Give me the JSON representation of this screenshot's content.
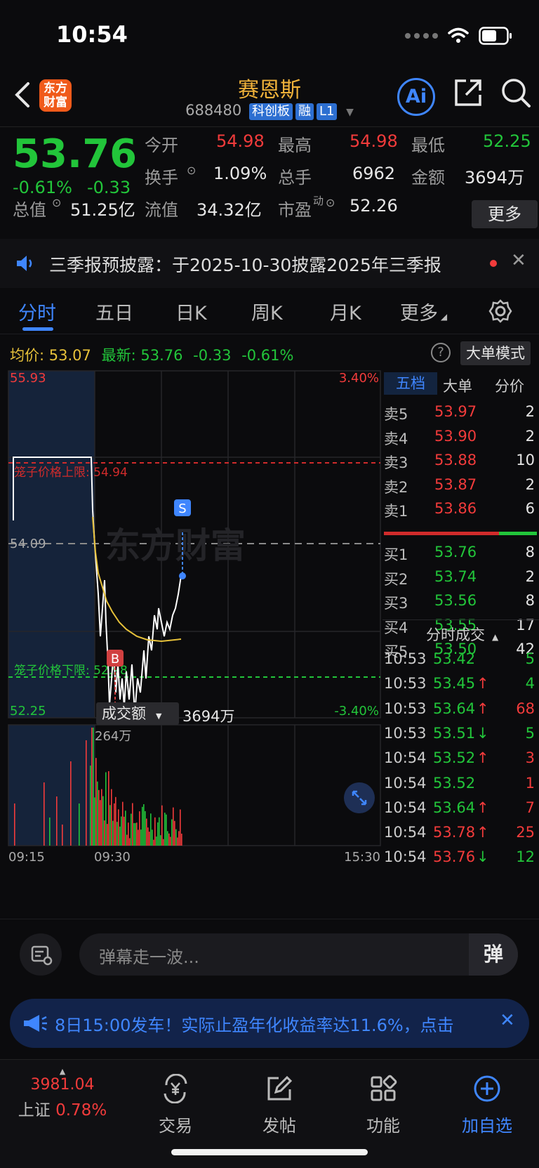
{
  "status_bar": {
    "time": "10:54"
  },
  "header": {
    "logo_text": "东方财富",
    "stock_name": "赛恩斯",
    "code": "688480",
    "tags": [
      "科创板",
      "融",
      "L1"
    ],
    "ai_label": "Ai"
  },
  "quote": {
    "price": "53.76",
    "change_pct": "-0.61%",
    "change": "-0.33",
    "fields": {
      "open_label": "今开",
      "open": "54.98",
      "high_label": "最高",
      "high": "54.98",
      "low_label": "最低",
      "low": "52.25",
      "turnover_label": "换手",
      "turnover": "1.09%",
      "volume_label": "总手",
      "volume": "6962",
      "amount_label": "金额",
      "amount": "3694万",
      "mktcap_label": "总值",
      "mktcap": "51.25亿",
      "float_label": "流值",
      "float": "34.32亿",
      "pe_label": "市盈",
      "pe_sup": "动",
      "pe": "52.26"
    },
    "more_label": "更多"
  },
  "notice": {
    "text": "三季报预披露：于2025-10-30披露2025年三季报"
  },
  "tabs": [
    "分时",
    "五日",
    "日K",
    "周K",
    "月K",
    "更多"
  ],
  "info_line": {
    "avg_label": "均价:",
    "avg": "53.07",
    "latest_label": "最新:",
    "latest": "53.76",
    "chg": "-0.33",
    "chg_pct": "-0.61%",
    "mode_label": "大单模式"
  },
  "chart": {
    "y_top": "55.93",
    "y_bottom": "52.25",
    "y_mid": "54.09",
    "pct_top": "3.40%",
    "pct_bottom": "-3.40%",
    "upper_label": "笼子价格上限: 54.94",
    "lower_label": "笼子价格下限: 52.98",
    "watermark": "东方财富",
    "sell_marker": "S",
    "buy_marker": "B",
    "indicator_label": "成交额",
    "indicator_value": "3694万",
    "vol_max_label": "264万",
    "x_labels": [
      "09:15",
      "09:30",
      "15:30"
    ],
    "colors": {
      "up": "#f23b3b",
      "down": "#22c53a",
      "avg": "#e6c13a",
      "price": "#ffffff"
    }
  },
  "orderbook": {
    "tabs": [
      "五档",
      "大单",
      "分价"
    ],
    "asks": [
      {
        "label": "卖5",
        "price": "53.97",
        "vol": "2"
      },
      {
        "label": "卖4",
        "price": "53.90",
        "vol": "2"
      },
      {
        "label": "卖3",
        "price": "53.88",
        "vol": "10"
      },
      {
        "label": "卖2",
        "price": "53.87",
        "vol": "2"
      },
      {
        "label": "卖1",
        "price": "53.86",
        "vol": "6"
      }
    ],
    "bids": [
      {
        "label": "买1",
        "price": "53.76",
        "vol": "8"
      },
      {
        "label": "买2",
        "price": "53.74",
        "vol": "2"
      },
      {
        "label": "买3",
        "price": "53.56",
        "vol": "8"
      },
      {
        "label": "买4",
        "price": "53.55",
        "vol": "17"
      },
      {
        "label": "买5",
        "price": "53.50",
        "vol": "42"
      }
    ],
    "ticks_title": "分时成交",
    "ticks": [
      {
        "time": "10:53",
        "price": "53.42",
        "dir": "",
        "vol": "5",
        "vc": "green"
      },
      {
        "time": "10:53",
        "price": "53.45",
        "dir": "↑",
        "vol": "4",
        "vc": "green"
      },
      {
        "time": "10:53",
        "price": "53.64",
        "dir": "↑",
        "vol": "68",
        "vc": "red"
      },
      {
        "time": "10:53",
        "price": "53.51",
        "dir": "↓",
        "vol": "5",
        "vc": "green"
      },
      {
        "time": "10:54",
        "price": "53.52",
        "dir": "↑",
        "vol": "3",
        "vc": "red"
      },
      {
        "time": "10:54",
        "price": "53.52",
        "dir": "",
        "vol": "1",
        "vc": "red"
      },
      {
        "time": "10:54",
        "price": "53.64",
        "dir": "↑",
        "vol": "7",
        "vc": "red"
      },
      {
        "time": "10:54",
        "price": "53.78",
        "dir": "↑",
        "vol": "25",
        "vc": "red"
      },
      {
        "time": "10:54",
        "price": "53.76",
        "dir": "↓",
        "vol": "12",
        "vc": "green"
      }
    ]
  },
  "danmu": {
    "placeholder": "弹幕走一波...",
    "btn": "弹"
  },
  "ad": {
    "text": "8日15:00发车！实际止盈年化收益率达11.6%，点击"
  },
  "nav": {
    "index_value": "3981.04",
    "index_name": "上证",
    "index_pct": "0.78%",
    "items": [
      "交易",
      "发帖",
      "功能",
      "加自选"
    ]
  }
}
